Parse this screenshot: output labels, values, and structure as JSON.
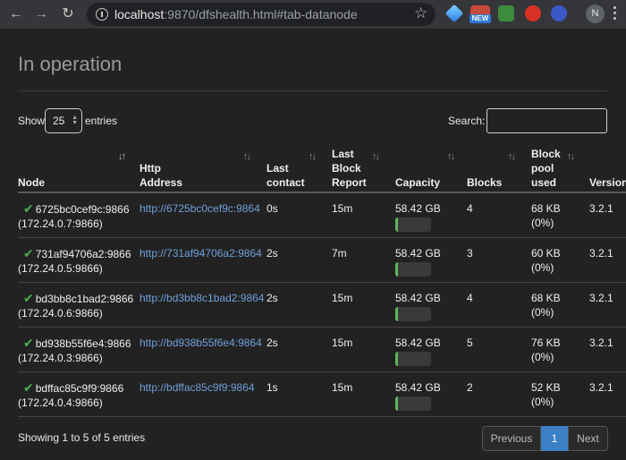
{
  "browser": {
    "url_host": "localhost",
    "url_rest": ":9870/dfshealth.html#tab-datanode",
    "ext_badge": "NEW",
    "avatar_letter": "N"
  },
  "page": {
    "title": "In operation",
    "show_label": "Show",
    "page_length": "25",
    "entries_label": "entries",
    "search_label": "Search:",
    "search_value": ""
  },
  "table": {
    "headers": [
      {
        "label": "Node"
      },
      {
        "label": "Http Address"
      },
      {
        "label": "Last\ncontact"
      },
      {
        "label": "Last\nBlock\nReport"
      },
      {
        "label": "Capacity"
      },
      {
        "label": "Blocks"
      },
      {
        "label": "Block\npool\nused"
      },
      {
        "label": "Version"
      }
    ],
    "rows": [
      {
        "node": "6725bc0cef9c:9866",
        "ip": "(172.24.0.7:9866)",
        "http": "http://6725bc0cef9c:9864",
        "contact": "0s",
        "report": "15m",
        "capacity": "58.42 GB",
        "used_pct": 2,
        "blocks": "4",
        "pool": "68 KB",
        "pool_pct": "(0%)",
        "version": "3.2.1"
      },
      {
        "node": "731af94706a2:9866",
        "ip": "(172.24.0.5:9866)",
        "http": "http://731af94706a2:9864",
        "contact": "2s",
        "report": "7m",
        "capacity": "58.42 GB",
        "used_pct": 2,
        "blocks": "3",
        "pool": "60 KB",
        "pool_pct": "(0%)",
        "version": "3.2.1"
      },
      {
        "node": "bd3bb8c1bad2:9866",
        "ip": "(172.24.0.6:9866)",
        "http": "http://bd3bb8c1bad2:9864",
        "contact": "2s",
        "report": "15m",
        "capacity": "58.42 GB",
        "used_pct": 2,
        "blocks": "4",
        "pool": "68 KB",
        "pool_pct": "(0%)",
        "version": "3.2.1"
      },
      {
        "node": "bd938b55f6e4:9866",
        "ip": "(172.24.0.3:9866)",
        "http": "http://bd938b55f6e4:9864",
        "contact": "2s",
        "report": "15m",
        "capacity": "58.42 GB",
        "used_pct": 2,
        "blocks": "5",
        "pool": "76 KB",
        "pool_pct": "(0%)",
        "version": "3.2.1"
      },
      {
        "node": "bdffac85c9f9:9866",
        "ip": "(172.24.0.4:9866)",
        "http": "http://bdffac85c9f9:9864",
        "contact": "1s",
        "report": "15m",
        "capacity": "58.42 GB",
        "used_pct": 2,
        "blocks": "2",
        "pool": "52 KB",
        "pool_pct": "(0%)",
        "version": "3.2.1"
      }
    ]
  },
  "footer": {
    "info": "Showing 1 to 5 of 5 entries",
    "prev_label": "Previous",
    "current_page": "1",
    "next_label": "Next"
  }
}
